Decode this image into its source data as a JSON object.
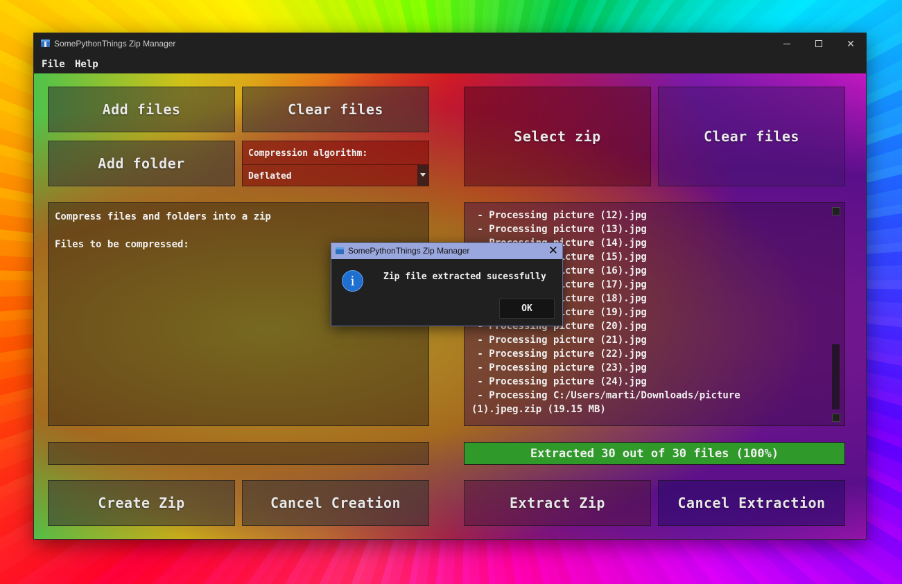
{
  "window": {
    "title": "SomePythonThings Zip Manager",
    "min_glyph": "",
    "close_glyph": "✕"
  },
  "menu": {
    "file": "File",
    "help": "Help"
  },
  "compress": {
    "add_files": "Add files",
    "clear_files": "Clear files",
    "add_folder": "Add folder",
    "algorithm_label": "Compression algorithm:",
    "algorithm_value": "Deflated",
    "text_lines": "Compress files and folders into a zip\n\nFiles to be compressed:",
    "create_zip": "Create Zip",
    "cancel_creation": "Cancel Creation",
    "progress_percent": 0
  },
  "extract": {
    "select_zip": "Select zip",
    "clear_files": "Clear files",
    "log_lines": " - Processing picture (12).jpg\n - Processing picture (13).jpg\n - Processing picture (14).jpg\n - Processing picture (15).jpg\n - Processing picture (16).jpg\n - Processing picture (17).jpg\n - Processing picture (18).jpg\n - Processing picture (19).jpg\n - Processing picture (20).jpg\n - Processing picture (21).jpg\n - Processing picture (22).jpg\n - Processing picture (23).jpg\n - Processing picture (24).jpg\n - Processing C:/Users/marti/Downloads/picture\n(1).jpeg.zip (19.15 MB)",
    "progress_text": "Extracted 30 out of 30 files (100%)",
    "progress_percent": 100,
    "extract_zip": "Extract Zip",
    "cancel_extraction": "Cancel Extraction"
  },
  "dialog": {
    "title": "SomePythonThings Zip Manager",
    "icon": "info-icon",
    "icon_glyph": "i",
    "close_glyph": "✕",
    "message": "Zip file extracted sucessfully",
    "ok": "OK"
  },
  "colors": {
    "progress_fill": "#2f9a2a",
    "dialog_title_bar": "#9aa7de",
    "info_icon": "#1f6fd1"
  }
}
